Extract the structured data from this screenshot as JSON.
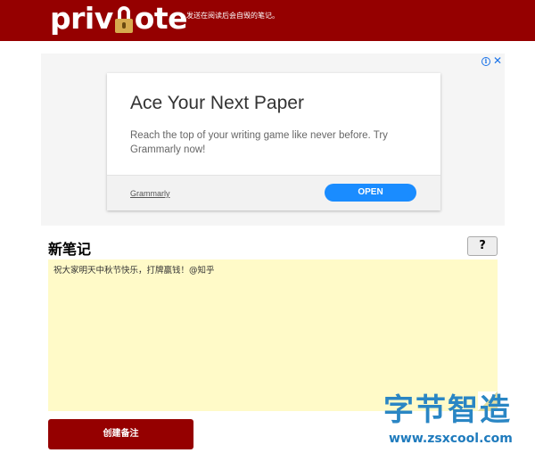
{
  "header": {
    "logo_text_before": "priv",
    "logo_text_after": "ote",
    "tagline": "发送在阅读后会自毁的笔记。"
  },
  "ad": {
    "title": "Ace Your Next Paper",
    "description": "Reach the top of your writing game like never before. Try Grammarly now!",
    "brand": "Grammarly",
    "cta": "OPEN",
    "info_icon": "i",
    "close_icon": "✕"
  },
  "note": {
    "title": "新笔记",
    "help_label": "?",
    "content": "祝大家明天中秋节快乐，打牌赢钱！@知乎",
    "create_label": "创建备注"
  },
  "watermark": {
    "title": "字节智造",
    "url": "www.zsxcool.com"
  },
  "colors": {
    "brand_red": "#950000",
    "note_bg": "#fffac8",
    "ad_cta": "#1a8cff"
  }
}
